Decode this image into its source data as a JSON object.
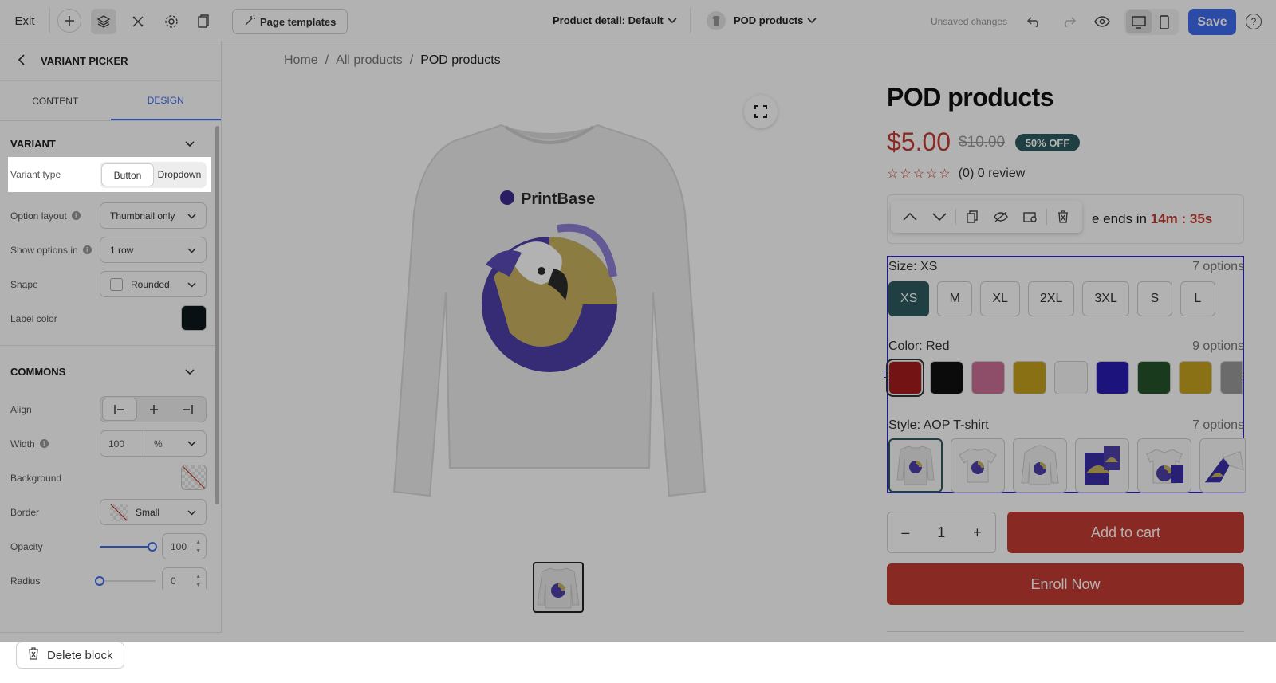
{
  "topbar": {
    "exit_label": "Exit",
    "page_templates_label": "Page templates",
    "page_select_label": "Product detail: Default",
    "product_select_label": "POD products",
    "unsaved_label": "Unsaved changes",
    "save_label": "Save",
    "accent_color": "#3e6cf0"
  },
  "sidebar": {
    "title": "VARIANT PICKER",
    "tabs": [
      {
        "label": "CONTENT"
      },
      {
        "label": "DESIGN",
        "active": true
      }
    ],
    "variant_section": {
      "title": "VARIANT",
      "variant_type_label": "Variant type",
      "variant_type_options": [
        "Button",
        "Dropdown"
      ],
      "variant_type_selected": "Button",
      "option_layout_label": "Option layout",
      "option_layout_value": "Thumbnail only",
      "show_options_label": "Show options in",
      "show_options_value": "1 row",
      "shape_label": "Shape",
      "shape_value": "Rounded",
      "label_color_label": "Label color",
      "label_color_value": "#0c181c"
    },
    "commons_section": {
      "title": "COMMONS",
      "align_label": "Align",
      "align_selected": "left",
      "width_label": "Width",
      "width_value": "100",
      "width_unit": "%",
      "background_label": "Background",
      "border_label": "Border",
      "border_value": "Small",
      "opacity_label": "Opacity",
      "opacity_value": "100",
      "radius_label": "Radius",
      "radius_value": "0"
    },
    "delete_label": "Delete block"
  },
  "canvas": {
    "breadcrumb": [
      "Home",
      "/",
      "All products",
      "/",
      "POD products"
    ],
    "product_title": "POD products",
    "price": "$5.00",
    "old_price": "$10.00",
    "discount_badge": "50% OFF",
    "review_text": "(0) 0 review",
    "timer_prefix": "e ends in",
    "timer_value": "14m : 35s",
    "size_label": "Size: XS",
    "size_count": "7 options",
    "sizes": [
      "XS",
      "M",
      "XL",
      "2XL",
      "3XL",
      "S",
      "L"
    ],
    "color_label": "Color: Red",
    "color_count": "9 options",
    "colors": [
      "#a51c1c",
      "#111111",
      "#cc6f97",
      "#c4a11f",
      "#f7f7f7",
      "#2a1cb4",
      "#24532a",
      "#c7a21f",
      "#9a9a9a"
    ],
    "style_label": "Style: AOP T-shirt",
    "style_count": "7 options",
    "quantity": "1",
    "minus": "–",
    "plus": "+",
    "add_to_cart": "Add to cart",
    "enroll": "Enroll Now",
    "brand_text": "PrintBase",
    "brand_color": "#c43b33",
    "badge_color": "#2f5b60"
  }
}
